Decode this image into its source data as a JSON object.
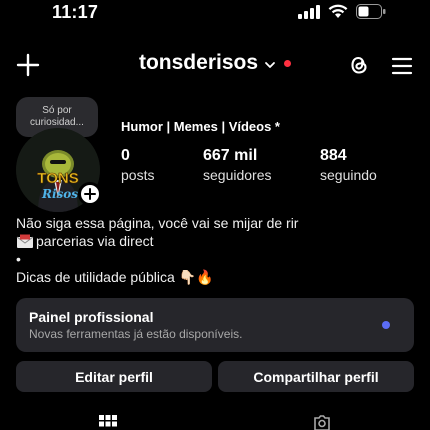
{
  "status_bar": {
    "time": "11:17"
  },
  "header": {
    "username": "tonsderisos"
  },
  "profile": {
    "note": "Só por\ncuriosidad...",
    "category": "Humor | Memes | Vídeos *",
    "stats": [
      {
        "value": "0",
        "label": "posts"
      },
      {
        "value": "667 mil",
        "label": "seguidores"
      },
      {
        "value": "884",
        "label": "seguindo"
      }
    ],
    "avatar_text": {
      "line1": "TONS",
      "line2": "Risos"
    },
    "bio": {
      "line1": "Não siga essa página, você vai se mijar de rir",
      "line2": "parcerias via direct",
      "line3": "•",
      "line4": "Dicas de utilidade pública 👇🏻🔥"
    }
  },
  "professional_panel": {
    "title": "Painel profissional",
    "subtitle": "Novas ferramentas já estão disponíveis."
  },
  "actions": {
    "edit_label": "Editar perfil",
    "share_label": "Compartilhar perfil"
  },
  "colors": {
    "background": "#000000",
    "surface": "#26262b",
    "notification_dot": "#ff3040",
    "panel_dot": "#5b6cf5"
  }
}
